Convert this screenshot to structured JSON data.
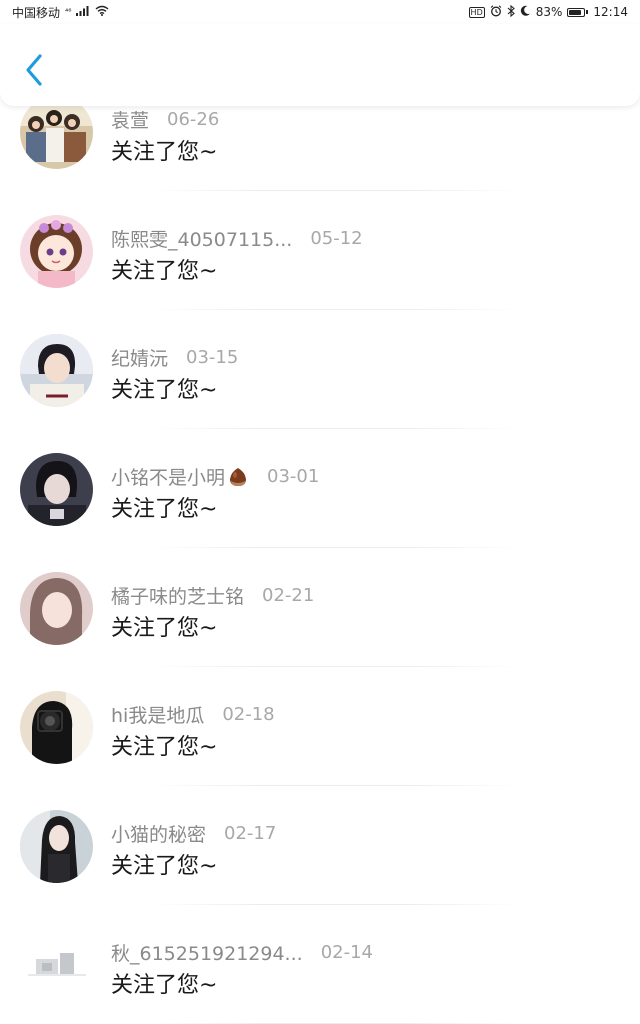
{
  "status_bar": {
    "carrier": "中国移动",
    "signal_badge": "⁴⁶",
    "hd_badge": "HD",
    "battery_percent": "83%",
    "battery_level": 0.83,
    "time": "12:14"
  },
  "header": {
    "back_icon": "chevron-left-icon",
    "accent_color": "#1f9be0"
  },
  "followers": [
    {
      "name": "袁萱",
      "date": "06-26",
      "message": "关注了您~",
      "avatar": "group-photo"
    },
    {
      "name": "陈熙雯_40507115...",
      "date": "05-12",
      "message": "关注了您~",
      "avatar": "anime-girl"
    },
    {
      "name": "纪婧沅",
      "date": "03-15",
      "message": "关注了您~",
      "avatar": "boy-portrait"
    },
    {
      "name": "小铭不是小明",
      "date": "03-01",
      "message": "关注了您~",
      "avatar": "dark-portrait",
      "emoji": "chestnut-icon"
    },
    {
      "name": "橘子味的芝士铭",
      "date": "02-21",
      "message": "关注了您~",
      "avatar": "soft-portrait"
    },
    {
      "name": "hi我是地瓜",
      "date": "02-18",
      "message": "关注了您~",
      "avatar": "camera-portrait"
    },
    {
      "name": "小猫的秘密",
      "date": "02-17",
      "message": "关注了您~",
      "avatar": "long-hair-girl"
    },
    {
      "name": "秋_615251921294...",
      "date": "02-14",
      "message": "关注了您~",
      "avatar": "faded-image"
    }
  ]
}
